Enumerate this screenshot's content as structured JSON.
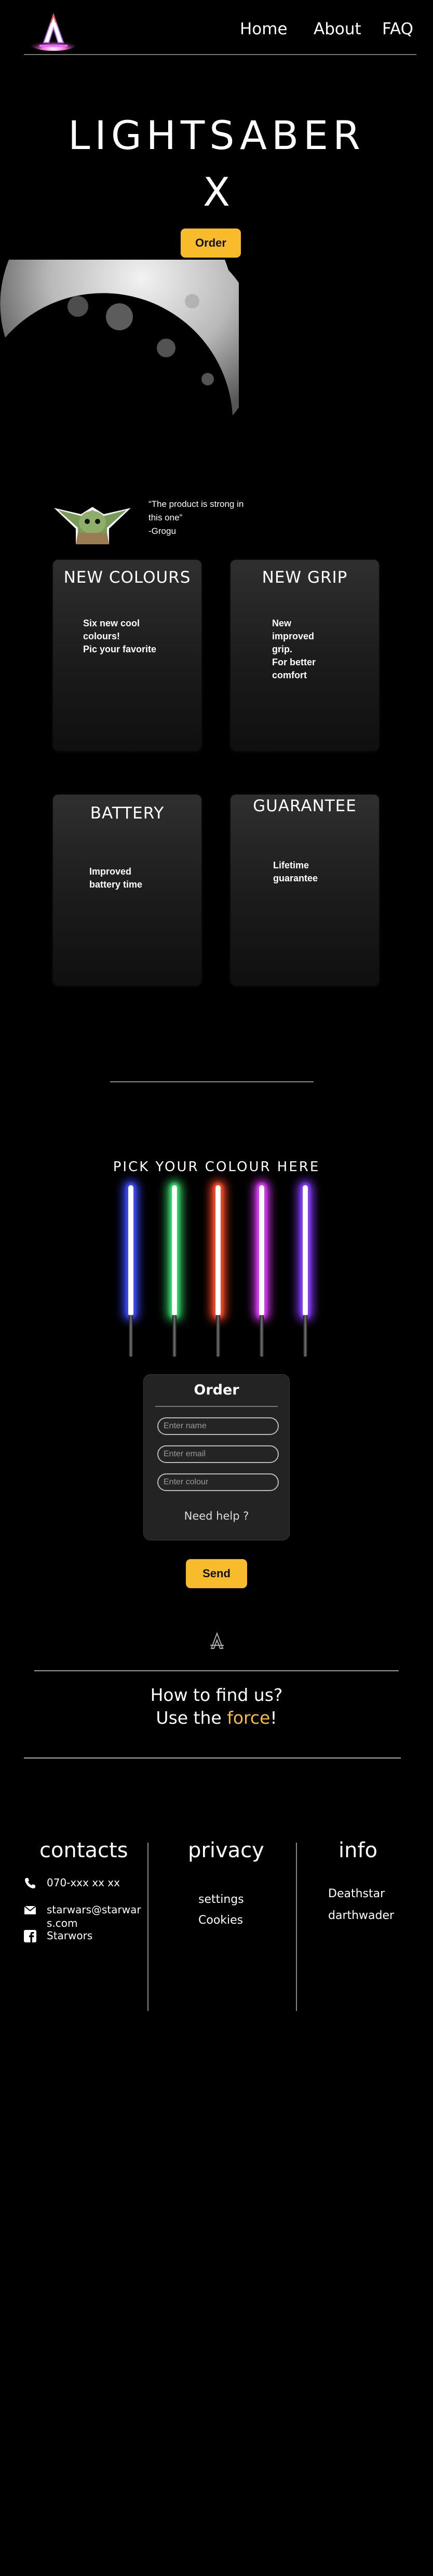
{
  "header": {
    "nav": {
      "home": "Home",
      "about": "About",
      "faq": "FAQ"
    }
  },
  "hero": {
    "title": "LIGHTSABER",
    "x": "X",
    "order_button": "Order"
  },
  "quote": {
    "text": "“The product is strong in this one”\n  -Grogu"
  },
  "features": {
    "colours": {
      "title": "NEW COLOURS",
      "text": "Six new cool\ncolours!\nPic your favorite"
    },
    "grip": {
      "title": "NEW GRIP",
      "text": "New\nimproved\ngrip.\nFor better\ncomfort"
    },
    "battery": {
      "title": "BATTERY",
      "text": "Improved\nbattery time"
    },
    "guarantee": {
      "title": "GUARANTEE",
      "text": "Lifetime\nguarantee"
    }
  },
  "picker": {
    "title": "PICK YOUR COLOUR HERE",
    "sabers": [
      {
        "name": "blue",
        "color": "#3f4bff"
      },
      {
        "name": "green",
        "color": "#38d36a"
      },
      {
        "name": "red",
        "color": "#ff4a2a"
      },
      {
        "name": "magenta",
        "color": "#e13cff"
      },
      {
        "name": "purple",
        "color": "#8a3cff"
      }
    ]
  },
  "form": {
    "title": "Order",
    "name_placeholder": "Enter name",
    "email_placeholder": "Enter email",
    "colour_placeholder": "Enter colour",
    "help": "Need help ?",
    "send": "Send"
  },
  "find": {
    "line1": "How to find us?",
    "line2_prefix": "Use the ",
    "line2_highlight": "force",
    "line2_suffix": "!"
  },
  "footer": {
    "contacts": {
      "title": "contacts",
      "phone": "070-xxx xx xx",
      "email": "starwars@starwars.com",
      "facebook": "Starwors"
    },
    "privacy": {
      "title": "privacy",
      "settings": "settings",
      "cookies": "Cookies"
    },
    "info": {
      "title": "info",
      "deathstar": "Deathstar",
      "darthwader": "darthwader"
    }
  },
  "colors": {
    "accent": "#f8bb2b",
    "background": "#000000",
    "card": "#1b1b1b"
  }
}
